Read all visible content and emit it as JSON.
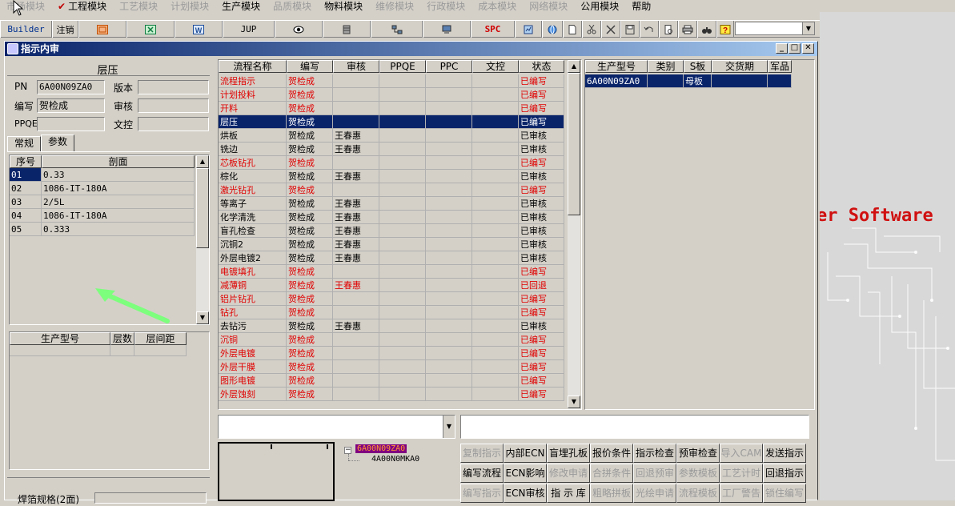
{
  "menu": [
    {
      "label": "市场模块",
      "disabled": true,
      "checked": false
    },
    {
      "label": "工程模块",
      "disabled": false,
      "checked": true
    },
    {
      "label": "工艺模块",
      "disabled": true,
      "checked": false
    },
    {
      "label": "计划模块",
      "disabled": true,
      "checked": false
    },
    {
      "label": "生产模块",
      "disabled": false,
      "checked": false
    },
    {
      "label": "品质模块",
      "disabled": true,
      "checked": false
    },
    {
      "label": "物料模块",
      "disabled": false,
      "checked": false
    },
    {
      "label": "维修模块",
      "disabled": true,
      "checked": false
    },
    {
      "label": "行政模块",
      "disabled": true,
      "checked": false
    },
    {
      "label": "成本模块",
      "disabled": true,
      "checked": false
    },
    {
      "label": "网络模块",
      "disabled": true,
      "checked": false
    },
    {
      "label": "公用模块",
      "disabled": false,
      "checked": false
    },
    {
      "label": "帮助",
      "disabled": false,
      "checked": false
    }
  ],
  "toolbar": {
    "builder": "Builder",
    "logout": "注销",
    "jup": "JUP",
    "spc": "SPC"
  },
  "window": {
    "title": "指示内审"
  },
  "left": {
    "section_title": "层压",
    "pn_label": "PN",
    "pn_value": "6A00N09ZA0",
    "version_label": "版本",
    "version_value": "",
    "editor_label": "编写",
    "editor_value": "贺检成",
    "reviewer_label": "审核",
    "reviewer_value": "",
    "ppqe_label": "PPQE",
    "ppqe_value": "",
    "control_label": "文控",
    "control_value": "",
    "tabs": [
      "常规",
      "参数"
    ],
    "param_headers": [
      "序号",
      "剖面"
    ],
    "params": [
      {
        "no": "01",
        "profile": "0.33"
      },
      {
        "no": "02",
        "profile": "1086-IT-180A"
      },
      {
        "no": "03",
        "profile": "2/5L"
      },
      {
        "no": "04",
        "profile": "1086-IT-180A"
      },
      {
        "no": "05",
        "profile": "0.333"
      }
    ],
    "lower_headers": [
      "生产型号",
      "层数",
      "层间距"
    ],
    "bottom_label": "焊箔规格(2面)"
  },
  "flow": {
    "headers": [
      "流程名称",
      "编写",
      "审核",
      "PPQE",
      "PPC",
      "文控",
      "状态"
    ],
    "rows": [
      {
        "name": "流程指示",
        "editor": "贺检成",
        "reviewer": "",
        "status": "已编写",
        "red": true
      },
      {
        "name": "计划投料",
        "editor": "贺检成",
        "reviewer": "",
        "status": "已编写",
        "red": true
      },
      {
        "name": "开料",
        "editor": "贺检成",
        "reviewer": "",
        "status": "已编写",
        "red": true
      },
      {
        "name": "层压",
        "editor": "贺检成",
        "reviewer": "",
        "status": "已编写",
        "red": true,
        "selected": true
      },
      {
        "name": "烘板",
        "editor": "贺检成",
        "reviewer": "王春惠",
        "status": "已审核",
        "red": false
      },
      {
        "name": "铣边",
        "editor": "贺检成",
        "reviewer": "王春惠",
        "status": "已审核",
        "red": false
      },
      {
        "name": "芯板钻孔",
        "editor": "贺检成",
        "reviewer": "",
        "status": "已编写",
        "red": true
      },
      {
        "name": "棕化",
        "editor": "贺检成",
        "reviewer": "王春惠",
        "status": "已审核",
        "red": false
      },
      {
        "name": "激光钻孔",
        "editor": "贺检成",
        "reviewer": "",
        "status": "已编写",
        "red": true
      },
      {
        "name": "等离子",
        "editor": "贺检成",
        "reviewer": "王春惠",
        "status": "已审核",
        "red": false
      },
      {
        "name": "化学清洗",
        "editor": "贺检成",
        "reviewer": "王春惠",
        "status": "已审核",
        "red": false
      },
      {
        "name": "盲孔检查",
        "editor": "贺检成",
        "reviewer": "王春惠",
        "status": "已审核",
        "red": false
      },
      {
        "name": "沉铜2",
        "editor": "贺检成",
        "reviewer": "王春惠",
        "status": "已审核",
        "red": false
      },
      {
        "name": "外层电镀2",
        "editor": "贺检成",
        "reviewer": "王春惠",
        "status": "已审核",
        "red": false
      },
      {
        "name": "电镀填孔",
        "editor": "贺检成",
        "reviewer": "",
        "status": "已编写",
        "red": true
      },
      {
        "name": "减薄铜",
        "editor": "贺检成",
        "reviewer": "王春惠",
        "status": "已回退",
        "red": true
      },
      {
        "name": "铝片钻孔",
        "editor": "贺检成",
        "reviewer": "",
        "status": "已编写",
        "red": true
      },
      {
        "name": "钻孔",
        "editor": "贺检成",
        "reviewer": "",
        "status": "已编写",
        "red": true
      },
      {
        "name": "去钻污",
        "editor": "贺检成",
        "reviewer": "王春惠",
        "status": "已审核",
        "red": false
      },
      {
        "name": "沉铜",
        "editor": "贺检成",
        "reviewer": "",
        "status": "已编写",
        "red": true
      },
      {
        "name": "外层电镀",
        "editor": "贺检成",
        "reviewer": "",
        "status": "已编写",
        "red": true
      },
      {
        "name": "外层干膜",
        "editor": "贺检成",
        "reviewer": "",
        "status": "已编写",
        "red": true
      },
      {
        "name": "图形电镀",
        "editor": "贺检成",
        "reviewer": "",
        "status": "已编写",
        "red": true
      },
      {
        "name": "外层蚀刻",
        "editor": "贺检成",
        "reviewer": "",
        "status": "已编写",
        "red": true
      }
    ]
  },
  "model": {
    "headers": [
      "生产型号",
      "类别",
      "S板",
      "交货期",
      "军品"
    ],
    "rows": [
      {
        "model": "6A00N09ZA0",
        "category": "",
        "s_board": "母板",
        "delivery": "",
        "military": ""
      }
    ]
  },
  "tree": {
    "root": "6A00N09ZA0",
    "child": "4A00N0MKA0"
  },
  "buttons": [
    [
      {
        "label": "复制指示",
        "disabled": true
      },
      {
        "label": "内部ECN",
        "disabled": false
      },
      {
        "label": "盲埋孔板",
        "disabled": false
      },
      {
        "label": "报价条件",
        "disabled": false
      },
      {
        "label": "指示检查",
        "disabled": false
      },
      {
        "label": "预审检查",
        "disabled": false
      },
      {
        "label": "导入CAM",
        "disabled": true
      },
      {
        "label": "发送指示",
        "disabled": false
      }
    ],
    [
      {
        "label": "编写流程",
        "disabled": false
      },
      {
        "label": "ECN影响",
        "disabled": false
      },
      {
        "label": "修改申请",
        "disabled": true
      },
      {
        "label": "合拼条件",
        "disabled": true
      },
      {
        "label": "回退预审",
        "disabled": true
      },
      {
        "label": "参数模板",
        "disabled": true
      },
      {
        "label": "工艺计时",
        "disabled": true
      },
      {
        "label": "回退指示",
        "disabled": false
      }
    ],
    [
      {
        "label": "编写指示",
        "disabled": true
      },
      {
        "label": "ECN审核",
        "disabled": false
      },
      {
        "label": "指 示 库",
        "disabled": false
      },
      {
        "label": "粗略拼板",
        "disabled": true
      },
      {
        "label": "光绘申请",
        "disabled": true
      },
      {
        "label": "流程模板",
        "disabled": true
      },
      {
        "label": "工厂警告",
        "disabled": true
      },
      {
        "label": "锁住编写",
        "disabled": true
      }
    ]
  ],
  "background_logo": "er Software"
}
